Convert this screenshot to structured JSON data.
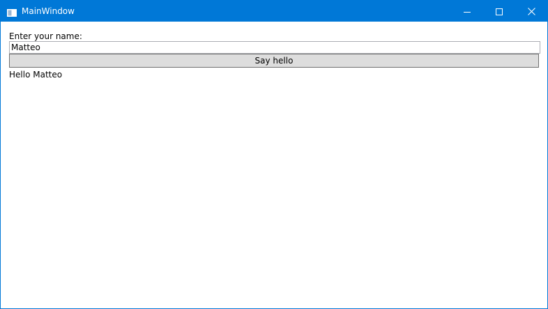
{
  "window": {
    "title": "MainWindow",
    "accent_color": "#0078d7",
    "icons": {
      "app": "window-app-icon",
      "minimize": "minimize-icon",
      "maximize": "maximize-icon",
      "close": "close-icon"
    }
  },
  "form": {
    "name_label": "Enter your name:",
    "name_value": "Matteo",
    "button_label": "Say hello",
    "greeting": "Hello Matteo"
  }
}
